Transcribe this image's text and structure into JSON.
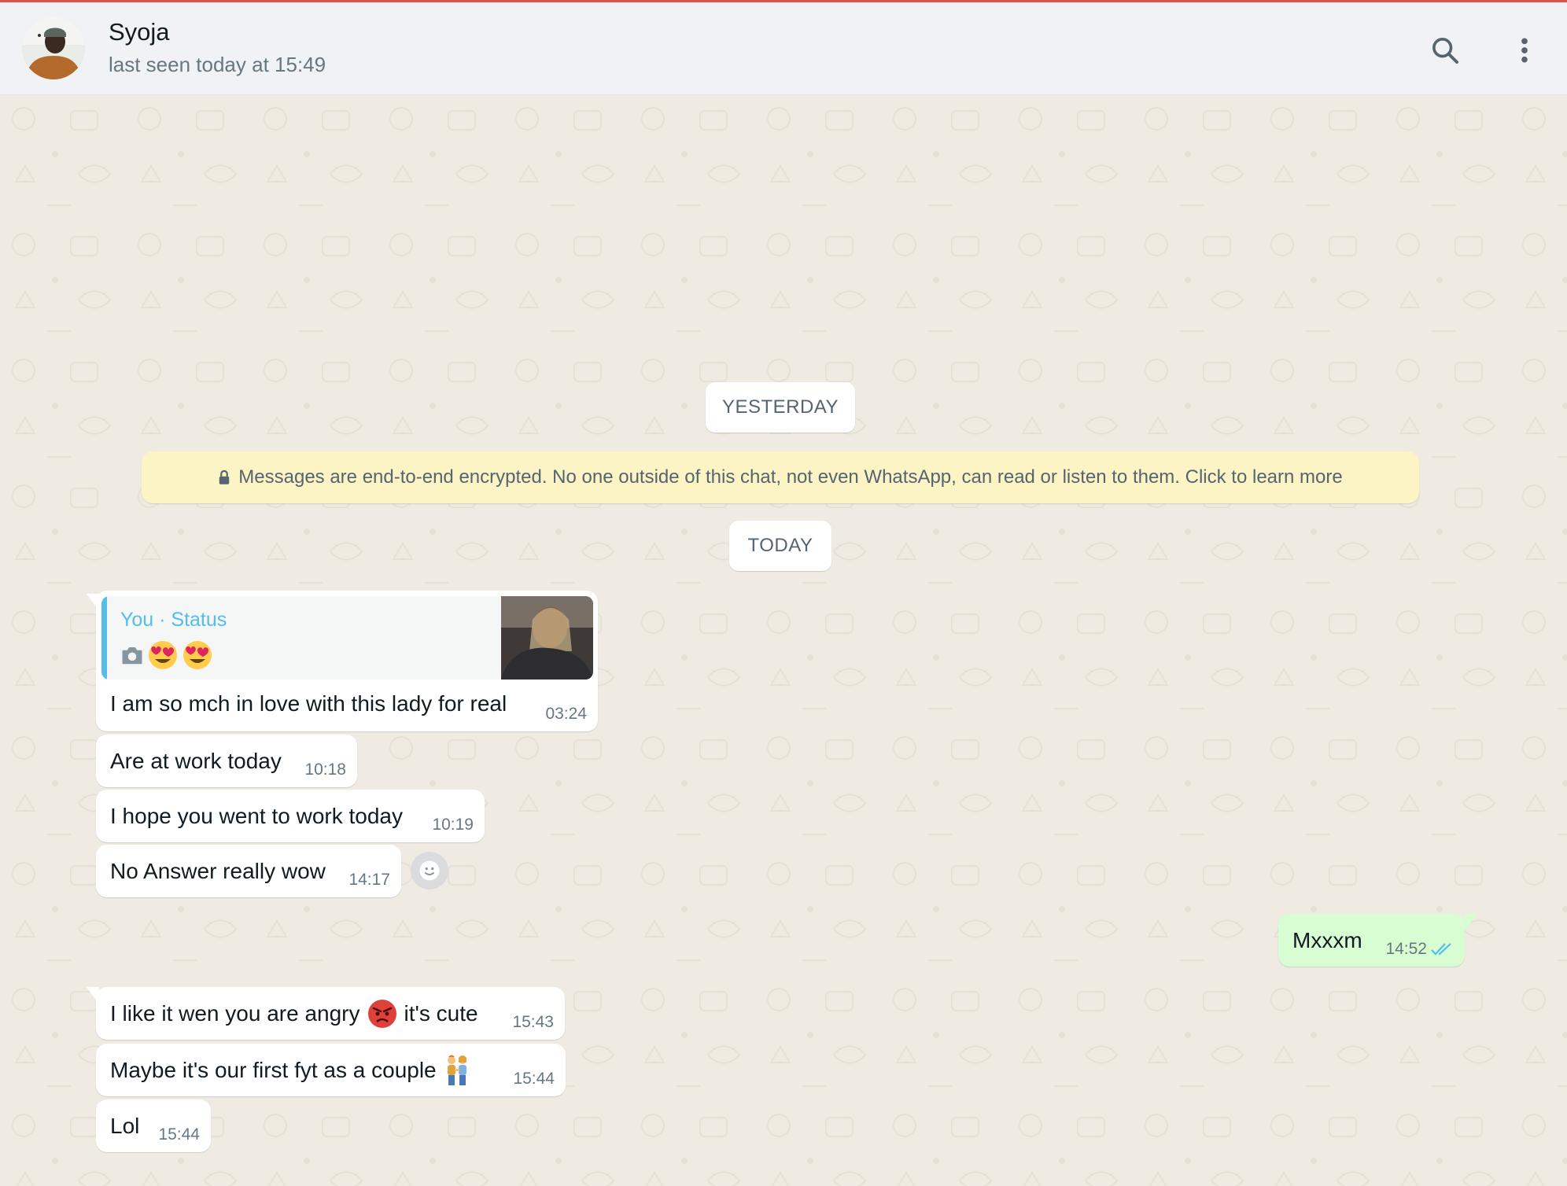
{
  "header": {
    "contact_name": "Syoja",
    "contact_status": "last seen today at 15:49",
    "icons": [
      "search-icon",
      "menu-icon"
    ]
  },
  "chat": {
    "date_yesterday": "YESTERDAY",
    "encryption_notice": "Messages are end-to-end encrypted. No one outside of this chat, not even WhatsApp, can read or listen to them. Click to learn more",
    "date_today": "TODAY",
    "quoted_status": {
      "author": "You · Status",
      "content_icons": [
        "camera-icon",
        "heart-eyes-emoji",
        "heart-eyes-emoji"
      ]
    },
    "messages": [
      {
        "direction": "in",
        "text": "I am so mch in love with this lady for real",
        "time": "03:24"
      },
      {
        "direction": "in",
        "text": "Are at work today",
        "time": "10:18"
      },
      {
        "direction": "in",
        "text": "I hope you went to work today",
        "time": "10:19"
      },
      {
        "direction": "in",
        "text": "No Answer really wow",
        "time": "14:17"
      },
      {
        "direction": "out",
        "text": "Mxxxm",
        "time": "14:52",
        "status": "read"
      },
      {
        "direction": "in",
        "text_before": "I like it wen you are angry",
        "emoji": "angry-face-emoji",
        "text_after": "it's cute",
        "time": "15:43"
      },
      {
        "direction": "in",
        "text": "Maybe it's our first fyt as a couple",
        "emoji": "couple-emoji",
        "time": "15:44"
      },
      {
        "direction": "in",
        "text": "Lol",
        "time": "15:44"
      }
    ]
  },
  "colors": {
    "header_bg": "#f0f2f5",
    "chat_bg": "#efeae2",
    "incoming_bubble": "#ffffff",
    "outgoing_bubble": "#d9fdd3",
    "encryption_bg": "#fdf4c5",
    "quote_accent": "#53bdeb",
    "read_ticks": "#53bdeb"
  }
}
